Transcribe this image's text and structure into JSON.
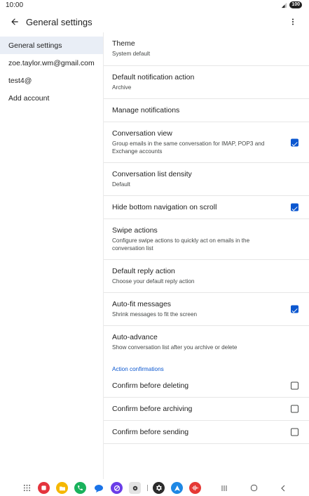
{
  "status": {
    "time": "10:00",
    "battery": "100"
  },
  "app_bar": {
    "title": "General settings"
  },
  "accounts": [
    {
      "label": "General settings",
      "selected": true
    },
    {
      "label": "zoe.taylor.wm@gmail.com",
      "selected": false
    },
    {
      "label": "test4@",
      "selected": false
    },
    {
      "label": "Add account",
      "selected": false
    }
  ],
  "settings": {
    "theme": {
      "title": "Theme",
      "sub": "System default"
    },
    "notification_action": {
      "title": "Default notification action",
      "sub": "Archive"
    },
    "manage_notifications": {
      "title": "Manage notifications"
    },
    "conversation_view": {
      "title": "Conversation view",
      "sub": "Group emails in the same conversation for IMAP, POP3 and Exchange accounts",
      "checked": true
    },
    "list_density": {
      "title": "Conversation list density",
      "sub": "Default"
    },
    "hide_bottom_nav": {
      "title": "Hide bottom navigation on scroll",
      "checked": true
    },
    "swipe_actions": {
      "title": "Swipe actions",
      "sub": "Configure swipe actions to quickly act on emails in the conversation list"
    },
    "reply_action": {
      "title": "Default reply action",
      "sub": "Choose your default reply action"
    },
    "auto_fit": {
      "title": "Auto-fit messages",
      "sub": "Shrink messages to fit the screen",
      "checked": true
    },
    "auto_advance": {
      "title": "Auto-advance",
      "sub": "Show conversation list after you archive or delete"
    },
    "section_label": "Action confirmations",
    "confirm_delete": {
      "title": "Confirm before deleting",
      "checked": false
    },
    "confirm_archive": {
      "title": "Confirm before archiving",
      "checked": false
    },
    "confirm_send": {
      "title": "Confirm before sending",
      "checked": false
    }
  },
  "dock": {
    "apps": [
      "app-grid-icon",
      "notes-icon",
      "folder-icon",
      "phone-icon",
      "messages-icon",
      "browser-icon",
      "camera-icon",
      "settings-icon",
      "maps-icon",
      "voice-recorder-icon"
    ],
    "nav": [
      "recent-apps-icon",
      "home-icon",
      "back-nav-icon"
    ]
  },
  "colors": {
    "accent": "#0b57d0",
    "selected_bg": "#e9eef6"
  }
}
